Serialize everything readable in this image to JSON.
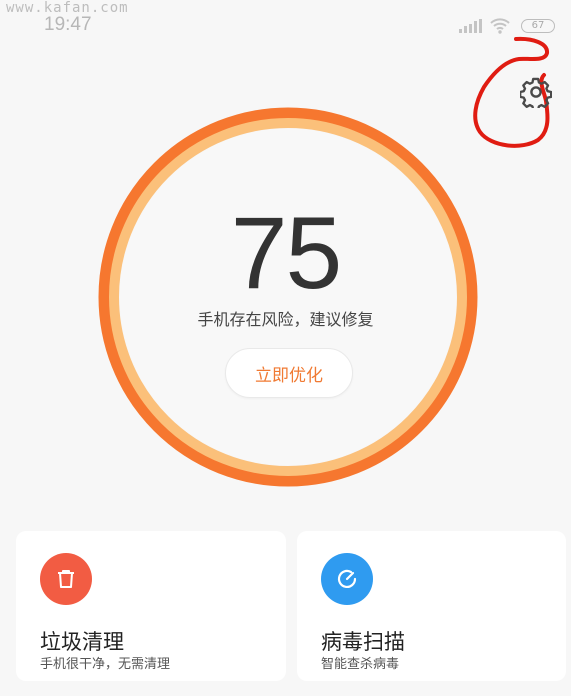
{
  "watermark": "www.kafan.com",
  "status_bar": {
    "time": "19:47",
    "battery": "67"
  },
  "colors": {
    "ring_outer": "#f6772f",
    "ring_inner": "#fbc07a",
    "accent": "#f07a33",
    "trash_icon_bg": "#f25c43",
    "scan_icon_bg": "#2f9bf0",
    "annotation": "#e01c12"
  },
  "header": {
    "settings_icon": "gear-icon"
  },
  "score": {
    "value": "75",
    "message": "手机存在风险，建议修复",
    "button_label": "立即优化"
  },
  "cards": [
    {
      "icon": "trash-icon",
      "title": "垃圾清理",
      "subtitle": "手机很干净，无需清理"
    },
    {
      "icon": "scan-icon",
      "title": "病毒扫描",
      "subtitle": "智能查杀病毒"
    }
  ]
}
